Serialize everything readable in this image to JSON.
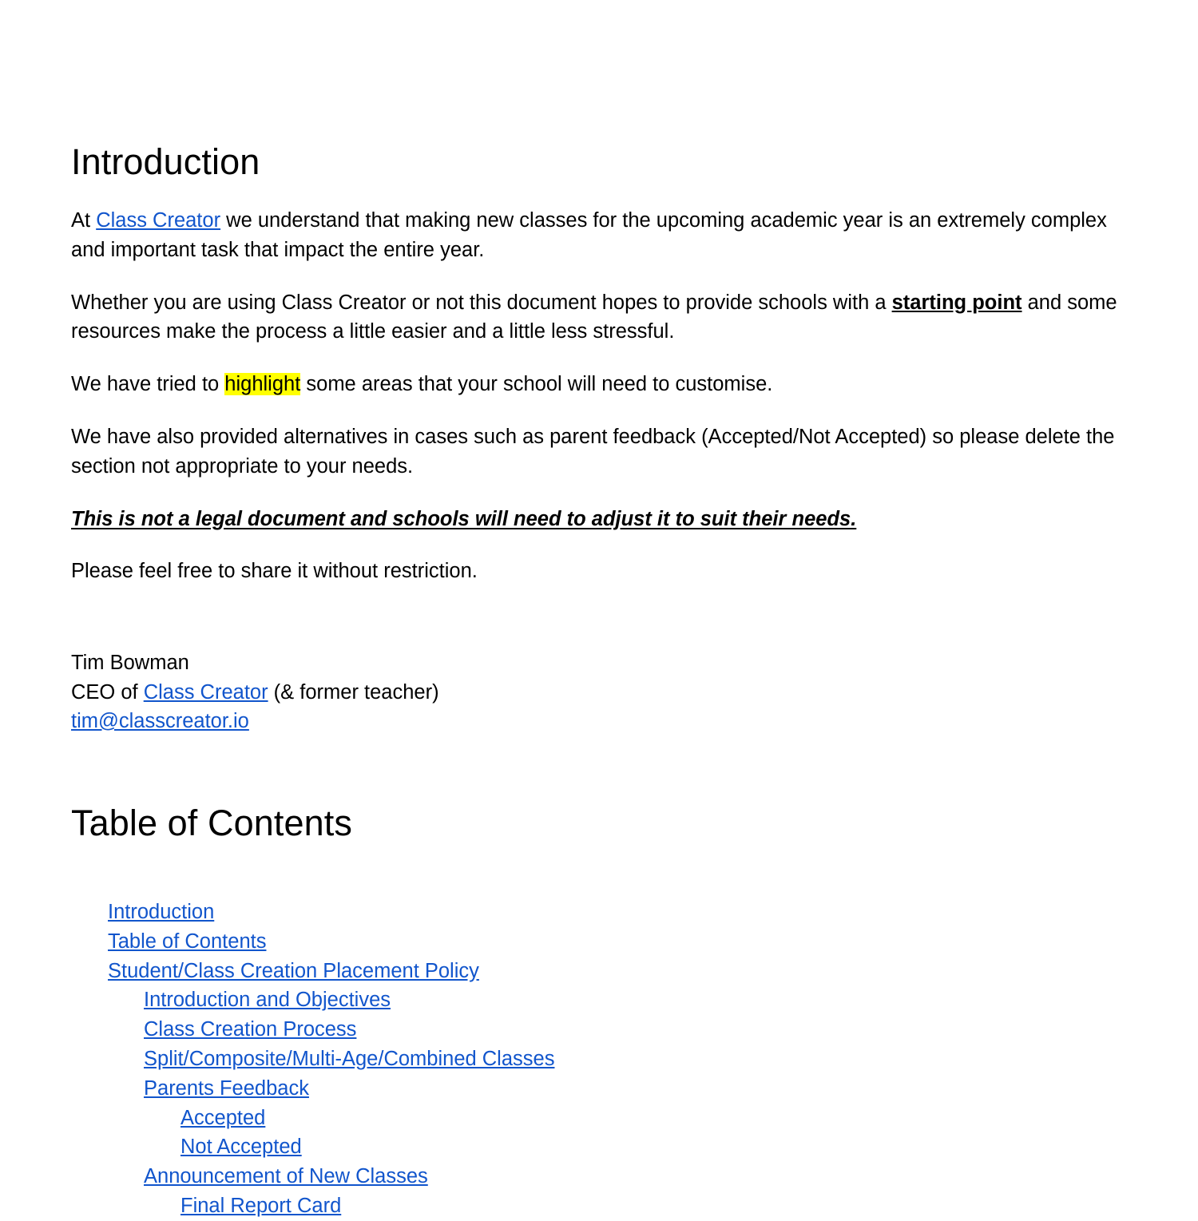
{
  "document": {
    "sections": {
      "introduction_heading": "Introduction",
      "toc_heading": "Table of Contents"
    },
    "colors": {
      "link": "#1155cc",
      "highlight": "#ffff00",
      "text": "#000000",
      "background": "#ffffff"
    }
  },
  "intro": {
    "p1": {
      "before_link": "At ",
      "link": "Class Creator",
      "after_link": "  we understand that making new classes for the upcoming academic year is an extremely complex and important task that impact the entire year."
    },
    "p2": {
      "before_bold": "Whether you are using Class Creator or not this document hopes to provide schools with a ",
      "bold_underline": "starting point",
      "after_bold": " and some resources make the process a little easier and a little less stressful."
    },
    "p3": {
      "before_highlight": "We have tried to ",
      "highlight": "highlight",
      "after_highlight": " some areas that your school will need to customise."
    },
    "p4": "We have also provided alternatives in cases such as parent feedback (Accepted/Not Accepted) so please delete the section not appropriate to your needs.",
    "p5_legal": "This is not a legal document and schools will need to adjust it to suit their needs.",
    "p6": "Please feel free to share it without restriction."
  },
  "signature": {
    "name": "Tim Bowman",
    "role_before_link": "CEO of ",
    "role_link": "Class Creator",
    "role_after_link": " (& former teacher)",
    "email": "tim@classcreator.io"
  },
  "toc": {
    "entries": [
      {
        "label": "Introduction",
        "level": 1
      },
      {
        "label": "Table of Contents",
        "level": 1
      },
      {
        "label": "Student/Class Creation Placement Policy",
        "level": 1
      },
      {
        "label": "Introduction and Objectives",
        "level": 2
      },
      {
        "label": "Class Creation Process",
        "level": 2
      },
      {
        "label": "Split/Composite/Multi-Age/Combined Classes",
        "level": 2
      },
      {
        "label": "Parents Feedback",
        "level": 2
      },
      {
        "label": "Accepted",
        "level": 3
      },
      {
        "label": "Not Accepted",
        "level": 3
      },
      {
        "label": "Announcement of New Classes",
        "level": 2
      },
      {
        "label": "Final Report Card",
        "level": 3
      }
    ]
  }
}
